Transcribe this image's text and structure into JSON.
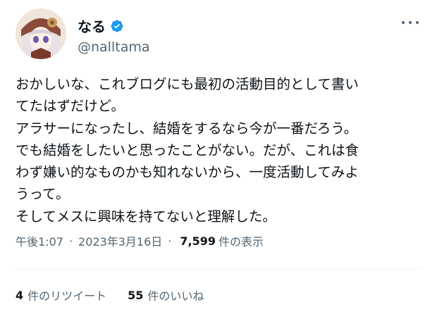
{
  "author": {
    "display_name": "なる",
    "handle": "@nalltama",
    "verified_icon": "verified-badge-icon",
    "avatar_icon": "avatar-anime-girl-icon"
  },
  "tweet": {
    "lines": [
      "おかしいな、これブログにも最初の活動目的として書い",
      "てたはずだけど。",
      "アラサーになったし、結婚をするなら今が一番だろう。",
      "でも結婚をしたいと思ったことがない。だが、これは食",
      "わず嫌い的なものかも知れないから、一度活動してみよ",
      "うって。",
      "そしてメスに興味を持てないと理解した。"
    ]
  },
  "meta": {
    "time": "午後1:07",
    "separator": "·",
    "date": "2023年3月16日",
    "views_count": "7,599",
    "views_label": "件の表示"
  },
  "stats": {
    "retweets_count": "4",
    "retweets_label": "件のリツイート",
    "likes_count": "55",
    "likes_label": "件のいいね"
  },
  "colors": {
    "text": "#0f1419",
    "secondary": "#536471",
    "verified": "#1d9bf0",
    "divider": "#eff3f4"
  }
}
